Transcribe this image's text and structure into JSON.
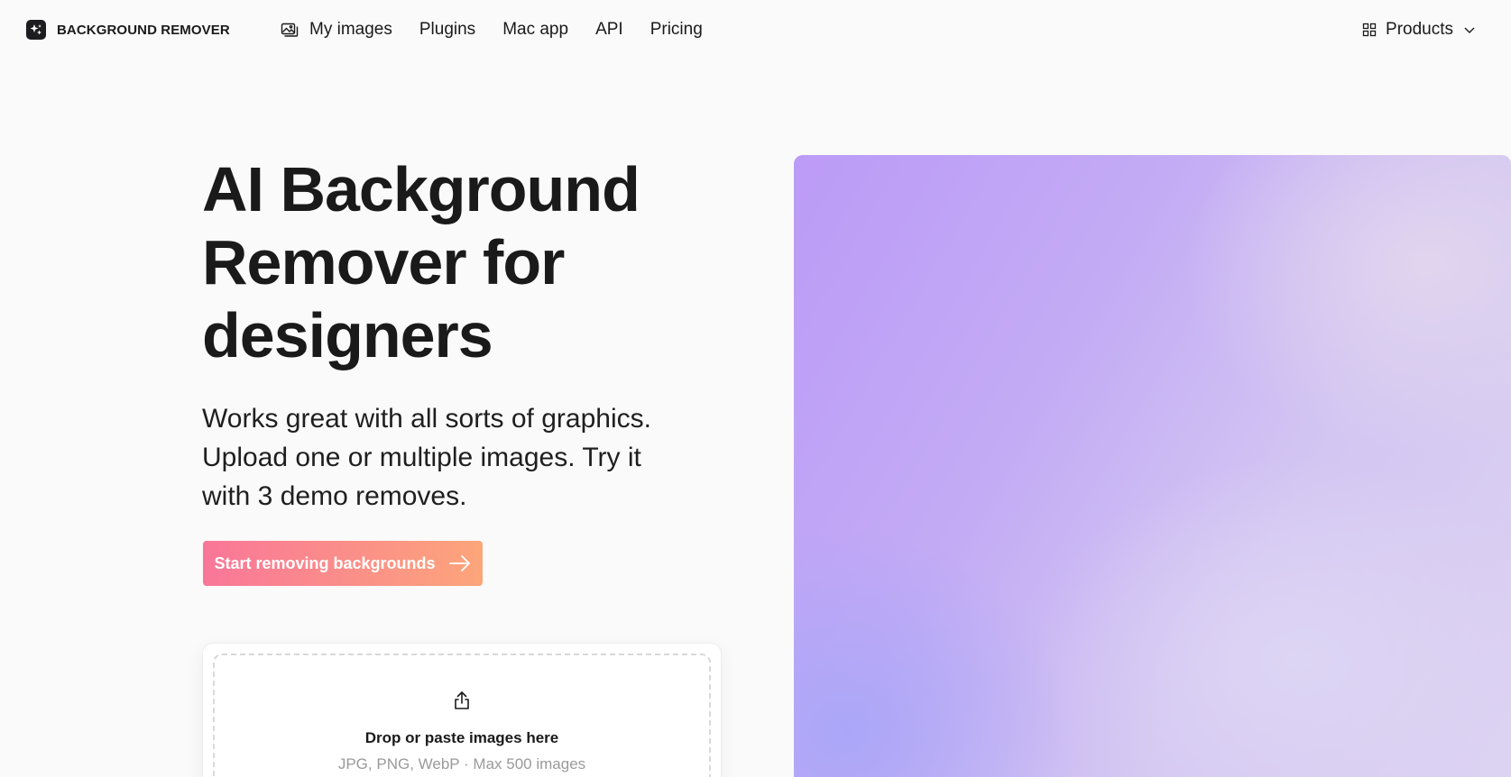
{
  "brand": {
    "name": "BACKGROUND REMOVER",
    "logo_icon": "sparkle-logo-icon"
  },
  "nav": {
    "items": [
      {
        "label": "My images",
        "icon": "image-icon"
      },
      {
        "label": "Plugins"
      },
      {
        "label": "Mac app"
      },
      {
        "label": "API"
      },
      {
        "label": "Pricing"
      }
    ],
    "products_label": "Products",
    "products_icon": "grid-icon"
  },
  "hero": {
    "title_lines": [
      "AI Background",
      "Remover for",
      "designers"
    ],
    "subtitle_lines": [
      "Works great with all sorts of graphics.",
      "Upload one or multiple images. Try it",
      "with 3 demo removes."
    ],
    "cta_label": "Start removing backgrounds"
  },
  "dropzone": {
    "title": "Drop or paste images here",
    "hint": "JPG, PNG, WebP · Max 500 images",
    "icon": "upload-icon"
  },
  "colors": {
    "cta_start": "#f97699",
    "cta_end": "#fca57a",
    "visual_start": "#bb9bf6",
    "visual_end": "#dcd2f1"
  }
}
